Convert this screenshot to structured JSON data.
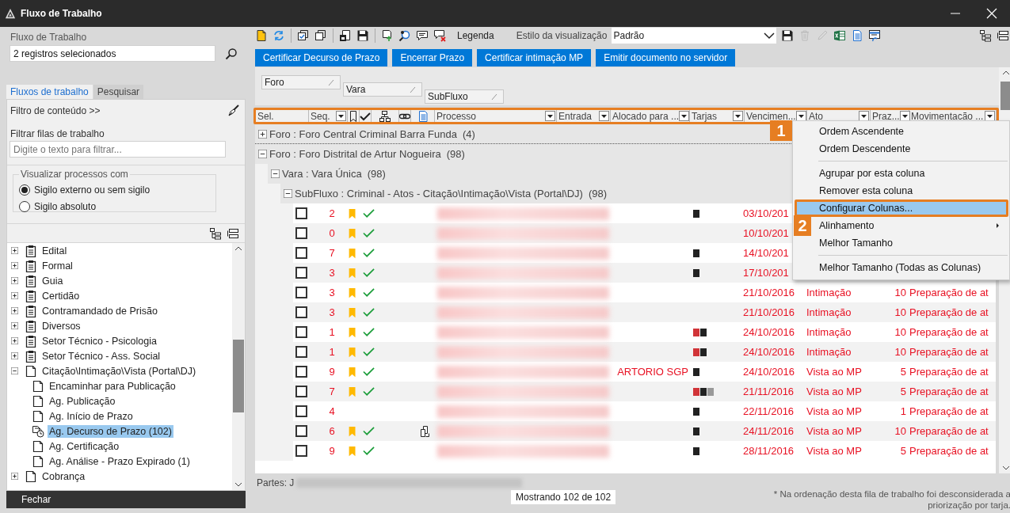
{
  "window": {
    "title": "Fluxo de Trabalho"
  },
  "sidebar": {
    "field_label": "Fluxo de Trabalho",
    "field_value": "2 registros selecionados",
    "tabs": [
      {
        "label": "Fluxos de trabalho",
        "selected": true
      },
      {
        "label": "Pesquisar",
        "selected": false
      }
    ],
    "filter_toggle": "Filtro de conteúdo >>",
    "filter_label": "Filtrar filas de trabalho",
    "filter_placeholder": "Digite o texto para filtrar...",
    "group_label": "Visualizar processos com",
    "radios": [
      {
        "label": "Sigilo externo ou sem sigilo",
        "selected": true
      },
      {
        "label": "Sigilo absoluto",
        "selected": false
      }
    ],
    "tree": [
      {
        "label": "Edital",
        "kind": "clipboard",
        "expanded": false,
        "selected": false
      },
      {
        "label": "Formal",
        "kind": "clipboard",
        "expanded": false,
        "selected": false
      },
      {
        "label": "Guia",
        "kind": "clipboard",
        "expanded": false,
        "selected": false
      },
      {
        "label": "Certidão",
        "kind": "clipboard",
        "expanded": false,
        "selected": false
      },
      {
        "label": "Contramandado de Prisão",
        "kind": "clipboard",
        "expanded": false,
        "selected": false
      },
      {
        "label": "Diversos",
        "kind": "clipboard",
        "expanded": false,
        "selected": false
      },
      {
        "label": "Setor Técnico - Psicologia",
        "kind": "clipboard",
        "expanded": false,
        "selected": false
      },
      {
        "label": "Setor Técnico - Ass. Social",
        "kind": "clipboard",
        "expanded": false,
        "selected": false
      },
      {
        "label": "Citação\\Intimação\\Vista (Portal\\DJ)",
        "kind": "page",
        "expanded": true,
        "selected": false,
        "children": [
          {
            "label": "Encaminhar para Publicação",
            "kind": "page",
            "selected": false
          },
          {
            "label": "Ag. Publicação",
            "kind": "page",
            "selected": false
          },
          {
            "label": "Ag. Início de Prazo",
            "kind": "page",
            "selected": false
          },
          {
            "label": "Ag. Decurso de Prazo (102)",
            "kind": "clock",
            "selected": true
          },
          {
            "label": "Ag. Certificação",
            "kind": "page",
            "selected": false
          },
          {
            "label": "Ag. Análise - Prazo Expirado (1)",
            "kind": "page",
            "selected": false
          }
        ]
      },
      {
        "label": "Cobrança",
        "kind": "page",
        "expanded": false,
        "selected": false
      }
    ],
    "close_button": "Fechar"
  },
  "toolbar": {
    "tools": [
      {
        "kind": "folder"
      },
      {
        "kind": "refresh"
      },
      {
        "kind": "separator"
      },
      {
        "kind": "checkcopy"
      },
      {
        "kind": "copy"
      },
      {
        "kind": "separator"
      },
      {
        "kind": "savelock"
      },
      {
        "kind": "save"
      },
      {
        "kind": "separator"
      },
      {
        "kind": "upload"
      },
      {
        "kind": "search"
      },
      {
        "kind": "comment"
      },
      {
        "kind": "commentx"
      }
    ],
    "legend": "Legenda",
    "view_style_label": "Estilo da visualização",
    "view_style": "Padrão",
    "view_tools": [
      {
        "kind": "save",
        "disabled": false
      },
      {
        "kind": "trash",
        "disabled": true
      },
      {
        "kind": "pencil",
        "disabled": true
      },
      {
        "kind": "spreadsheet",
        "disabled": false
      },
      {
        "kind": "document",
        "disabled": false
      },
      {
        "kind": "window",
        "disabled": false
      }
    ],
    "layout_tools": [
      {
        "kind": "tree"
      },
      {
        "kind": "rows"
      }
    ]
  },
  "actions": [
    "Certificar Decurso de Prazo",
    "Encerrar Prazo",
    "Certificar intimação MP",
    "Emitir documento no servidor"
  ],
  "group_by": [
    "Foro",
    "Vara",
    "SubFluxo"
  ],
  "columns": [
    {
      "kind": "text",
      "label": "Sel.",
      "dropdown": false
    },
    {
      "kind": "text",
      "label": "Seq.",
      "dropdown": true
    },
    {
      "kind": "bookmark"
    },
    {
      "kind": "check"
    },
    {
      "kind": "hierarchy"
    },
    {
      "kind": "link"
    },
    {
      "kind": "document"
    },
    {
      "kind": "text",
      "label": "Processo",
      "dropdown": true
    },
    {
      "kind": "text",
      "label": "Entrada",
      "dropdown": true
    },
    {
      "kind": "text",
      "label": "Alocado para ...",
      "dropdown": true
    },
    {
      "kind": "text",
      "label": "Tarjas",
      "dropdown": true
    },
    {
      "kind": "text",
      "label": "Vencimen...",
      "dropdown": true
    },
    {
      "kind": "text",
      "label": "Ato",
      "dropdown": true
    },
    {
      "kind": "text",
      "label": "Praz...",
      "dropdown": true
    },
    {
      "kind": "text",
      "label": "Movimentacão ...",
      "dropdown": true
    }
  ],
  "groups": [
    {
      "label": "Foro : Foro Central Criminal Barra Funda",
      "count": "(4)",
      "expanded": false
    },
    {
      "label": "Foro : Foro Distrital de Artur Nogueira",
      "count": "(98)",
      "expanded": true,
      "children": [
        {
          "label": "Vara : Vara Única",
          "count": "(98)",
          "expanded": true,
          "children": [
            {
              "label": "SubFluxo : Criminal - Atos - Citação\\Intimação\\Vista (Portal\\DJ)",
              "count": "(98)",
              "expanded": true,
              "rows": [
                {
                  "checked": false,
                  "seq": "2",
                  "bookmarked": true,
                  "verified": true,
                  "tarjas": [
                    {
                      "color": "#222222"
                    }
                  ],
                  "vencimento": "03/10/201"
                },
                {
                  "checked": false,
                  "seq": "0",
                  "bookmarked": true,
                  "verified": true,
                  "tarjas": [],
                  "vencimento": "10/10/201"
                },
                {
                  "checked": false,
                  "seq": "7",
                  "bookmarked": true,
                  "verified": true,
                  "tarjas": [
                    {
                      "color": "#222222"
                    }
                  ],
                  "vencimento": "14/10/201"
                },
                {
                  "checked": false,
                  "seq": "3",
                  "bookmarked": true,
                  "verified": true,
                  "tarjas": [
                    {
                      "color": "#222222"
                    }
                  ],
                  "vencimento": "17/10/201"
                },
                {
                  "checked": false,
                  "seq": "3",
                  "bookmarked": true,
                  "verified": true,
                  "tarjas": [],
                  "vencimento": "21/10/2016",
                  "ato": "Intimação",
                  "prazo": "10",
                  "movimentacao": "Preparação de at"
                },
                {
                  "checked": false,
                  "seq": "3",
                  "bookmarked": true,
                  "verified": true,
                  "tarjas": [],
                  "vencimento": "21/10/2016",
                  "ato": "Intimação",
                  "prazo": "10",
                  "movimentacao": "Preparação de at"
                },
                {
                  "checked": false,
                  "seq": "1",
                  "bookmarked": true,
                  "verified": true,
                  "tarjas": [
                    {
                      "color": "#d13438"
                    },
                    {
                      "color": "#222222"
                    }
                  ],
                  "vencimento": "24/10/2016",
                  "ato": "Intimação",
                  "prazo": "10",
                  "movimentacao": "Preparação de at"
                },
                {
                  "checked": false,
                  "seq": "1",
                  "bookmarked": true,
                  "verified": true,
                  "tarjas": [
                    {
                      "color": "#d13438"
                    },
                    {
                      "color": "#222222"
                    }
                  ],
                  "vencimento": "24/10/2016",
                  "ato": "Intimação",
                  "prazo": "10",
                  "movimentacao": "Preparação de at"
                },
                {
                  "checked": false,
                  "seq": "9",
                  "bookmarked": true,
                  "verified": true,
                  "alocado": "ARTORIO SGP",
                  "tarjas": [
                    {
                      "color": "#222222"
                    }
                  ],
                  "vencimento": "24/10/2016",
                  "ato": "Vista ao MP",
                  "prazo": "5",
                  "movimentacao": "Preparação de at"
                },
                {
                  "checked": false,
                  "seq": "7",
                  "bookmarked": true,
                  "verified": true,
                  "tarjas": [
                    {
                      "color": "#d13438"
                    },
                    {
                      "color": "#222222"
                    },
                    {
                      "color": "#999999"
                    }
                  ],
                  "vencimento": "21/11/2016",
                  "ato": "Vista ao MP",
                  "prazo": "5",
                  "movimentacao": "Preparação de at"
                },
                {
                  "checked": false,
                  "seq": "4",
                  "bookmarked": false,
                  "verified": false,
                  "tarjas": [
                    {
                      "color": "#222222"
                    }
                  ],
                  "vencimento": "22/11/2016",
                  "ato": "Vista ao MP",
                  "prazo": "1",
                  "movimentacao": "Preparação de at"
                },
                {
                  "checked": false,
                  "seq": "6",
                  "bookmarked": true,
                  "verified": true,
                  "attachment": true,
                  "tarjas": [
                    {
                      "color": "#222222"
                    }
                  ],
                  "vencimento": "24/11/2016",
                  "ato": "Vista ao MP",
                  "prazo": "10",
                  "movimentacao": "Preparação de at"
                },
                {
                  "checked": false,
                  "seq": "9",
                  "bookmarked": true,
                  "verified": true,
                  "tarjas": [
                    {
                      "color": "#222222"
                    }
                  ],
                  "vencimento": "28/11/2016",
                  "ato": "Vista ao MP",
                  "prazo": "5",
                  "movimentacao": "Preparação de at"
                }
              ]
            }
          ]
        }
      ]
    }
  ],
  "context_menu": [
    {
      "kind": "item",
      "label": "Ordem Ascendente",
      "selected": false
    },
    {
      "kind": "item",
      "label": "Ordem Descendente",
      "selected": false
    },
    {
      "kind": "separator"
    },
    {
      "kind": "item",
      "label": "Agrupar por esta coluna",
      "selected": false
    },
    {
      "kind": "item",
      "label": "Remover esta coluna",
      "selected": false
    },
    {
      "kind": "item",
      "label": "Configurar Colunas...",
      "selected": true
    },
    {
      "kind": "item",
      "label": "Alinhamento",
      "selected": false,
      "submenu": true
    },
    {
      "kind": "item",
      "label": "Melhor Tamanho",
      "selected": false
    },
    {
      "kind": "separator"
    },
    {
      "kind": "item",
      "label": "Melhor Tamanho (Todas as Colunas)",
      "selected": false
    }
  ],
  "annotations": [
    {
      "label": "1",
      "kind": "header"
    },
    {
      "label": "2",
      "kind": "menu"
    }
  ],
  "footer": {
    "parties_label": "Partes: J",
    "count": "Mostrando 102 de 102",
    "note": "* Na ordenação desta fila de trabalho foi desconsiderada a priorização por tarja."
  }
}
